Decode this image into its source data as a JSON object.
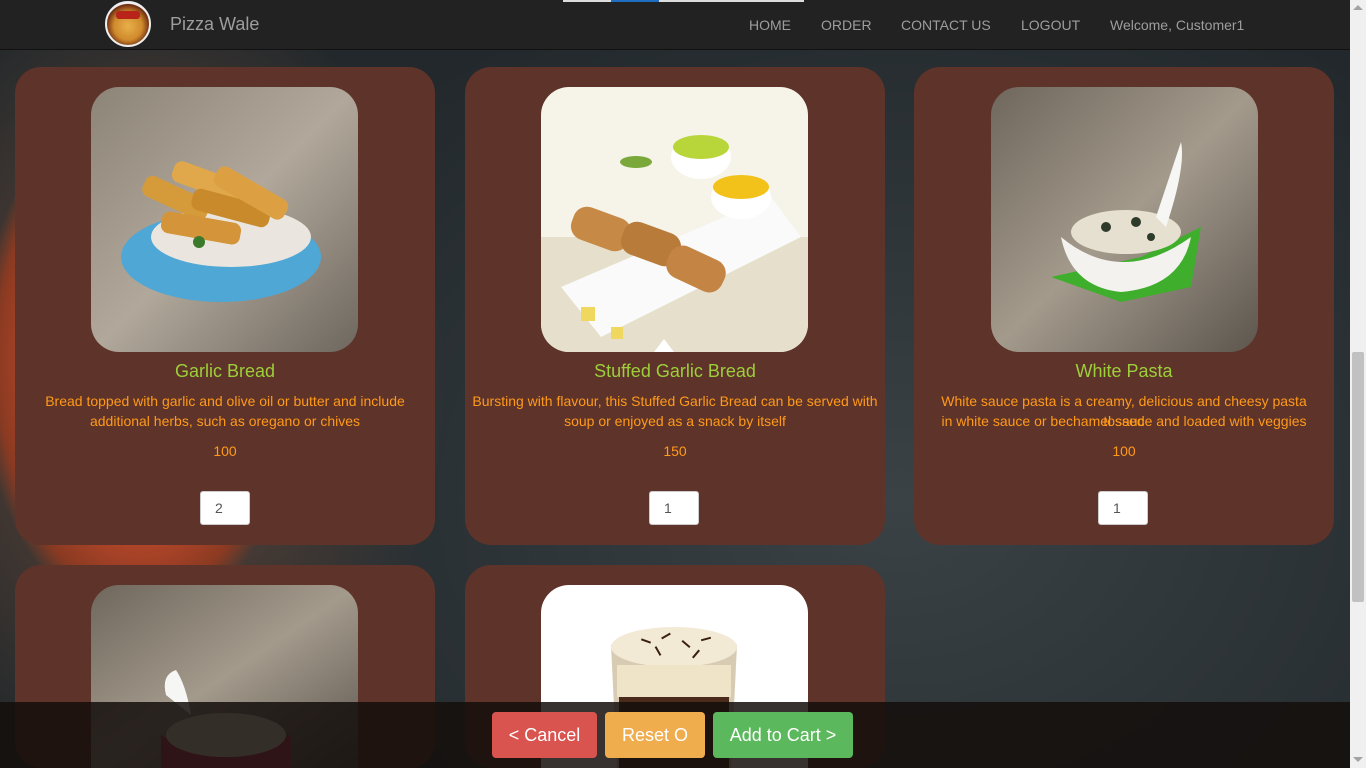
{
  "header": {
    "brand": "Pizza Wale",
    "nav": [
      {
        "label": "HOME"
      },
      {
        "label": "ORDER"
      },
      {
        "label": "CONTACT US"
      },
      {
        "label": "LOGOUT"
      }
    ],
    "welcome": "Welcome, Customer1"
  },
  "items": [
    {
      "name": "Garlic Bread",
      "description_line1": "Bread topped with garlic and olive oil or butter and include",
      "description_line2": "additional herbs, such as oregano or chives",
      "price": "100",
      "quantity": "2"
    },
    {
      "name": "Stuffed Garlic Bread",
      "description_line1": "Bursting with flavour, this Stuffed Garlic Bread can be served with",
      "description_line2": "soup or enjoyed as a snack by itself",
      "price": "150",
      "quantity": "1"
    },
    {
      "name": "White Pasta",
      "description_line1": "White sauce pasta is a creamy, delicious and cheesy pasta tossed",
      "description_line2": "in white sauce or bechamel sauce and loaded with veggies",
      "price": "100",
      "quantity": "1"
    }
  ],
  "actions": {
    "cancel": "< Cancel",
    "reset": "Reset O",
    "add_to_cart": "Add to Cart >"
  },
  "colors": {
    "card_bg": "#5e3329",
    "name": "#9ccf3a",
    "text": "#ff9a1a",
    "cancel": "#d9534f",
    "reset": "#f0ad4e",
    "add": "#5cb85c"
  }
}
